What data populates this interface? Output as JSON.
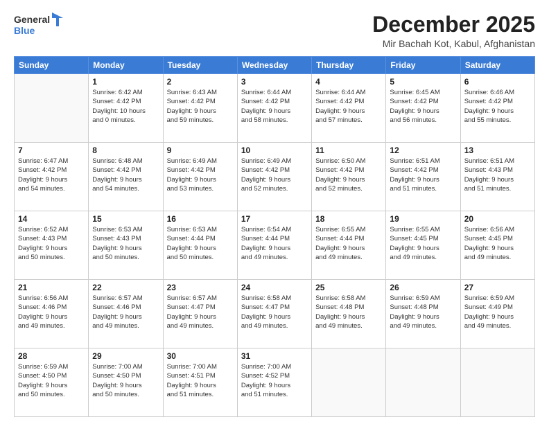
{
  "logo": {
    "general": "General",
    "blue": "Blue"
  },
  "header": {
    "month": "December 2025",
    "location": "Mir Bachah Kot, Kabul, Afghanistan"
  },
  "weekdays": [
    "Sunday",
    "Monday",
    "Tuesday",
    "Wednesday",
    "Thursday",
    "Friday",
    "Saturday"
  ],
  "weeks": [
    [
      {
        "day": "",
        "sunrise": "",
        "sunset": "",
        "daylight": "",
        "empty": true
      },
      {
        "day": "1",
        "sunrise": "Sunrise: 6:42 AM",
        "sunset": "Sunset: 4:42 PM",
        "daylight": "Daylight: 10 hours and 0 minutes."
      },
      {
        "day": "2",
        "sunrise": "Sunrise: 6:43 AM",
        "sunset": "Sunset: 4:42 PM",
        "daylight": "Daylight: 9 hours and 59 minutes."
      },
      {
        "day": "3",
        "sunrise": "Sunrise: 6:44 AM",
        "sunset": "Sunset: 4:42 PM",
        "daylight": "Daylight: 9 hours and 58 minutes."
      },
      {
        "day": "4",
        "sunrise": "Sunrise: 6:44 AM",
        "sunset": "Sunset: 4:42 PM",
        "daylight": "Daylight: 9 hours and 57 minutes."
      },
      {
        "day": "5",
        "sunrise": "Sunrise: 6:45 AM",
        "sunset": "Sunset: 4:42 PM",
        "daylight": "Daylight: 9 hours and 56 minutes."
      },
      {
        "day": "6",
        "sunrise": "Sunrise: 6:46 AM",
        "sunset": "Sunset: 4:42 PM",
        "daylight": "Daylight: 9 hours and 55 minutes."
      }
    ],
    [
      {
        "day": "7",
        "sunrise": "Sunrise: 6:47 AM",
        "sunset": "Sunset: 4:42 PM",
        "daylight": "Daylight: 9 hours and 54 minutes."
      },
      {
        "day": "8",
        "sunrise": "Sunrise: 6:48 AM",
        "sunset": "Sunset: 4:42 PM",
        "daylight": "Daylight: 9 hours and 54 minutes."
      },
      {
        "day": "9",
        "sunrise": "Sunrise: 6:49 AM",
        "sunset": "Sunset: 4:42 PM",
        "daylight": "Daylight: 9 hours and 53 minutes."
      },
      {
        "day": "10",
        "sunrise": "Sunrise: 6:49 AM",
        "sunset": "Sunset: 4:42 PM",
        "daylight": "Daylight: 9 hours and 52 minutes."
      },
      {
        "day": "11",
        "sunrise": "Sunrise: 6:50 AM",
        "sunset": "Sunset: 4:42 PM",
        "daylight": "Daylight: 9 hours and 52 minutes."
      },
      {
        "day": "12",
        "sunrise": "Sunrise: 6:51 AM",
        "sunset": "Sunset: 4:42 PM",
        "daylight": "Daylight: 9 hours and 51 minutes."
      },
      {
        "day": "13",
        "sunrise": "Sunrise: 6:51 AM",
        "sunset": "Sunset: 4:43 PM",
        "daylight": "Daylight: 9 hours and 51 minutes."
      }
    ],
    [
      {
        "day": "14",
        "sunrise": "Sunrise: 6:52 AM",
        "sunset": "Sunset: 4:43 PM",
        "daylight": "Daylight: 9 hours and 50 minutes."
      },
      {
        "day": "15",
        "sunrise": "Sunrise: 6:53 AM",
        "sunset": "Sunset: 4:43 PM",
        "daylight": "Daylight: 9 hours and 50 minutes."
      },
      {
        "day": "16",
        "sunrise": "Sunrise: 6:53 AM",
        "sunset": "Sunset: 4:44 PM",
        "daylight": "Daylight: 9 hours and 50 minutes."
      },
      {
        "day": "17",
        "sunrise": "Sunrise: 6:54 AM",
        "sunset": "Sunset: 4:44 PM",
        "daylight": "Daylight: 9 hours and 49 minutes."
      },
      {
        "day": "18",
        "sunrise": "Sunrise: 6:55 AM",
        "sunset": "Sunset: 4:44 PM",
        "daylight": "Daylight: 9 hours and 49 minutes."
      },
      {
        "day": "19",
        "sunrise": "Sunrise: 6:55 AM",
        "sunset": "Sunset: 4:45 PM",
        "daylight": "Daylight: 9 hours and 49 minutes."
      },
      {
        "day": "20",
        "sunrise": "Sunrise: 6:56 AM",
        "sunset": "Sunset: 4:45 PM",
        "daylight": "Daylight: 9 hours and 49 minutes."
      }
    ],
    [
      {
        "day": "21",
        "sunrise": "Sunrise: 6:56 AM",
        "sunset": "Sunset: 4:46 PM",
        "daylight": "Daylight: 9 hours and 49 minutes."
      },
      {
        "day": "22",
        "sunrise": "Sunrise: 6:57 AM",
        "sunset": "Sunset: 4:46 PM",
        "daylight": "Daylight: 9 hours and 49 minutes."
      },
      {
        "day": "23",
        "sunrise": "Sunrise: 6:57 AM",
        "sunset": "Sunset: 4:47 PM",
        "daylight": "Daylight: 9 hours and 49 minutes."
      },
      {
        "day": "24",
        "sunrise": "Sunrise: 6:58 AM",
        "sunset": "Sunset: 4:47 PM",
        "daylight": "Daylight: 9 hours and 49 minutes."
      },
      {
        "day": "25",
        "sunrise": "Sunrise: 6:58 AM",
        "sunset": "Sunset: 4:48 PM",
        "daylight": "Daylight: 9 hours and 49 minutes."
      },
      {
        "day": "26",
        "sunrise": "Sunrise: 6:59 AM",
        "sunset": "Sunset: 4:48 PM",
        "daylight": "Daylight: 9 hours and 49 minutes."
      },
      {
        "day": "27",
        "sunrise": "Sunrise: 6:59 AM",
        "sunset": "Sunset: 4:49 PM",
        "daylight": "Daylight: 9 hours and 49 minutes."
      }
    ],
    [
      {
        "day": "28",
        "sunrise": "Sunrise: 6:59 AM",
        "sunset": "Sunset: 4:50 PM",
        "daylight": "Daylight: 9 hours and 50 minutes."
      },
      {
        "day": "29",
        "sunrise": "Sunrise: 7:00 AM",
        "sunset": "Sunset: 4:50 PM",
        "daylight": "Daylight: 9 hours and 50 minutes."
      },
      {
        "day": "30",
        "sunrise": "Sunrise: 7:00 AM",
        "sunset": "Sunset: 4:51 PM",
        "daylight": "Daylight: 9 hours and 51 minutes."
      },
      {
        "day": "31",
        "sunrise": "Sunrise: 7:00 AM",
        "sunset": "Sunset: 4:52 PM",
        "daylight": "Daylight: 9 hours and 51 minutes."
      },
      {
        "day": "",
        "sunrise": "",
        "sunset": "",
        "daylight": "",
        "empty": true
      },
      {
        "day": "",
        "sunrise": "",
        "sunset": "",
        "daylight": "",
        "empty": true
      },
      {
        "day": "",
        "sunrise": "",
        "sunset": "",
        "daylight": "",
        "empty": true
      }
    ]
  ]
}
